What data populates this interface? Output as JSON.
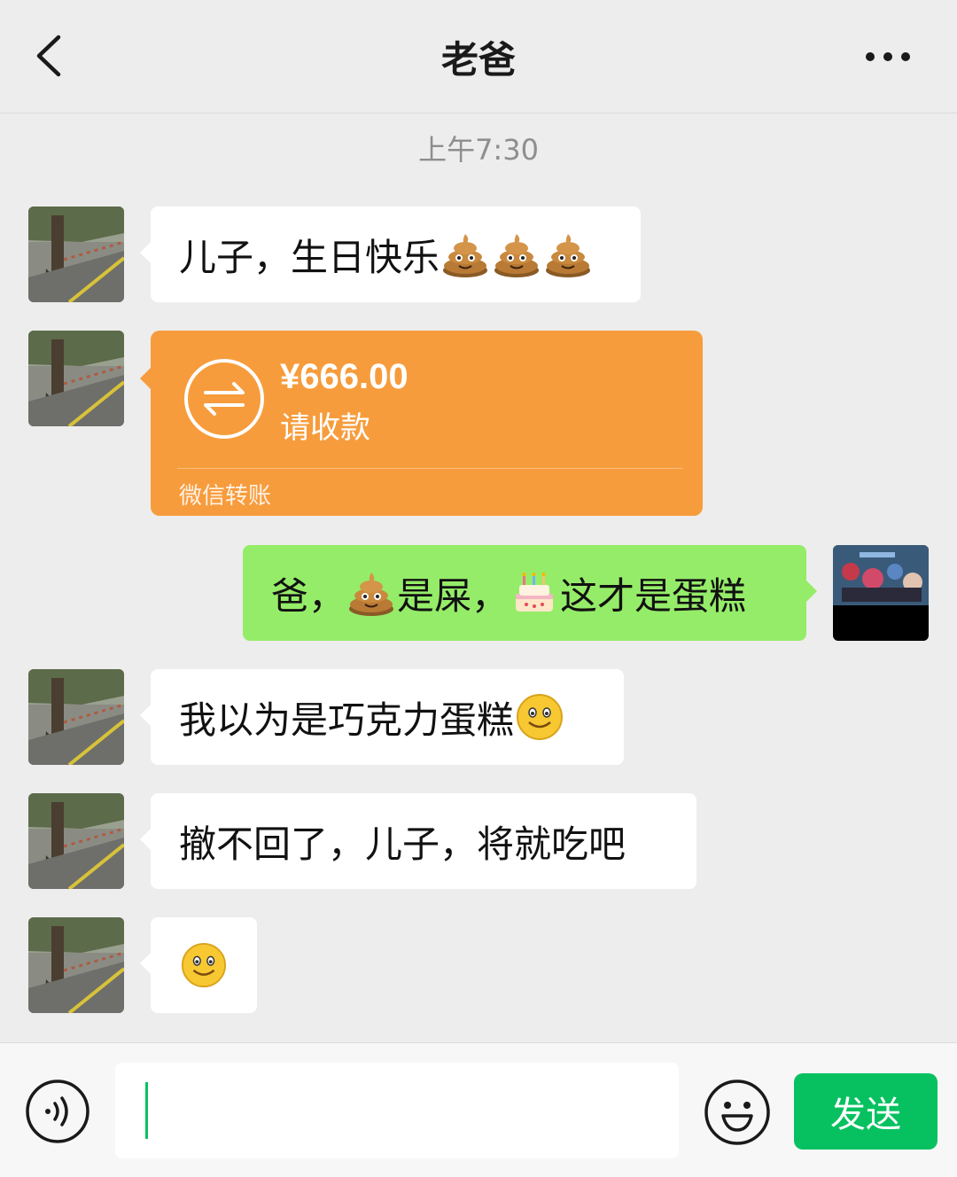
{
  "header": {
    "title": "老爸",
    "back_icon": "back-arrow-icon",
    "more_icon": "more-dots-icon"
  },
  "timestamp": "上午7:30",
  "messages": [
    {
      "sender": "contact",
      "type": "text",
      "text": "儿子，生日快乐",
      "emojis": [
        "poop",
        "poop",
        "poop"
      ]
    },
    {
      "sender": "contact",
      "type": "transfer",
      "amount": "¥666.00",
      "status": "请收款",
      "label": "微信转账"
    },
    {
      "sender": "me",
      "type": "text",
      "parts": [
        "爸，",
        "是屎，",
        "这才是蛋糕"
      ],
      "emojis": [
        "poop",
        "birthday-cake"
      ]
    },
    {
      "sender": "contact",
      "type": "text",
      "text": "我以为是巧克力蛋糕",
      "emojis": [
        "smile"
      ]
    },
    {
      "sender": "contact",
      "type": "text",
      "text": "撤不回了，儿子，将就吃吧"
    },
    {
      "sender": "contact",
      "type": "emoji",
      "emojis": [
        "smile"
      ]
    }
  ],
  "input_bar": {
    "voice_icon": "voice-icon",
    "input_value": "",
    "emoji_icon": "emoji-icon",
    "send_label": "发送"
  },
  "colors": {
    "background": "#ededed",
    "bubble_me": "#95ec69",
    "bubble_contact": "#ffffff",
    "transfer": "#f79c3c",
    "send_button": "#07c160"
  }
}
